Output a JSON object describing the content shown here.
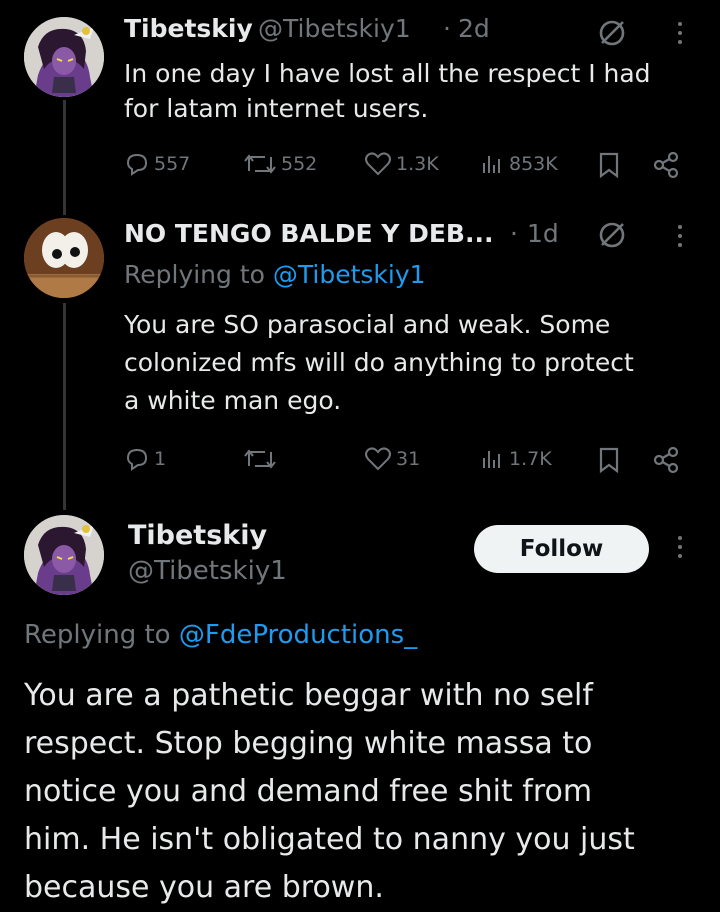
{
  "tweet1": {
    "display_name": "Tibetskiy",
    "handle": "@Tibetskiy1",
    "separator": "·",
    "time": "2d",
    "text_line1": "In one day I have lost all the respect I had",
    "text_line2": "for latam internet users.",
    "replies": "557",
    "reposts": "552",
    "likes": "1.3K",
    "views": "853K"
  },
  "tweet2": {
    "display_name": "NO TENGO BALDE Y DEB...",
    "separator": "·",
    "time": "1d",
    "replying_prefix": "Replying to",
    "replying_to": "@Tibetskiy1",
    "text_line1": "You are SO parasocial and weak. Some",
    "text_line2": "colonized mfs will do anything to protect",
    "text_line3": "a white man ego.",
    "replies": "1",
    "likes": "31",
    "views": "1.7K"
  },
  "tweet3": {
    "display_name": "Tibetskiy",
    "handle": "@Tibetskiy1",
    "follow_label": "Follow",
    "replying_prefix": "Replying to",
    "replying_to": "@FdeProductions_",
    "text_line1": "You are a pathetic beggar with no self",
    "text_line2": "respect. Stop begging white massa to",
    "text_line3": "notice you and demand free shit from",
    "text_line4": "him. He isn't obligated to nanny you just",
    "text_line5": "because you are brown."
  },
  "colors": {
    "background": "#000000",
    "text": "#e7e9ea",
    "muted": "#71767b",
    "link": "#1d9bf0",
    "thread_line": "#333639",
    "follow_bg": "#eff3f4"
  },
  "icons": [
    "no-entry-icon",
    "more-icon",
    "reply-icon",
    "repost-icon",
    "like-icon",
    "views-icon",
    "bookmark-icon",
    "share-icon"
  ]
}
